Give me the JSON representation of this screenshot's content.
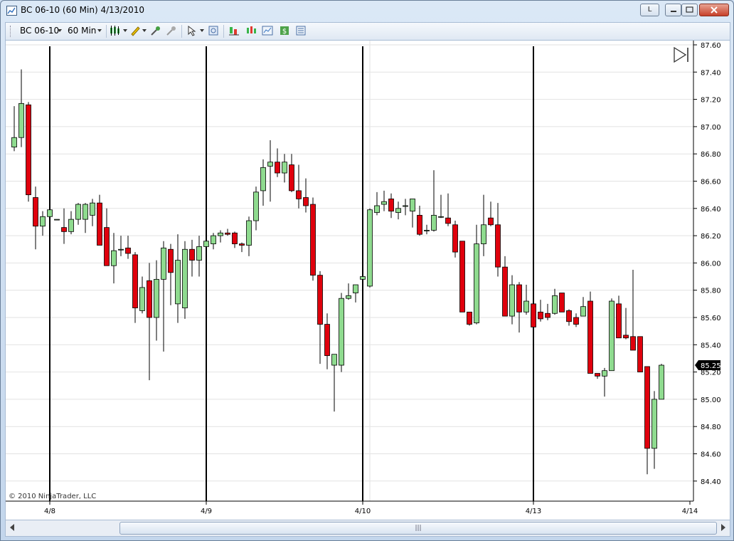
{
  "window": {
    "title": "BC 06-10 (60 Min)  4/13/2010",
    "buttons": {
      "minimize": "L"
    }
  },
  "toolbar": {
    "instrument": "BC 06-10",
    "interval": "60 Min"
  },
  "icons": [
    "chart-style-icon",
    "drawing-tool-icon",
    "zoom-in-icon",
    "zoom-out-icon",
    "cursor-icon",
    "data-box-icon",
    "indicators-icon",
    "strategies-icon",
    "chart-trader-icon",
    "dollar-icon",
    "properties-icon",
    "scroll-end-icon"
  ],
  "colors": {
    "up": "#8fdb8f",
    "down": "#e0000d",
    "wick": "#000000",
    "grid": "#e2e2e2",
    "sessionLine": "#000000",
    "priceMarker": "#000000"
  },
  "chart_data": {
    "type": "candlestick",
    "y_axis_side": "right",
    "ylim": [
      84.3,
      87.6
    ],
    "y_ticks": [
      "87.60",
      "87.40",
      "87.20",
      "87.00",
      "86.80",
      "86.60",
      "86.40",
      "86.20",
      "86.00",
      "85.80",
      "85.60",
      "85.40",
      "85.20",
      "85.00",
      "84.80",
      "84.60",
      "84.40"
    ],
    "x_ticks": [
      "4/8",
      "4/9",
      "4/10",
      "4/13",
      "4/14"
    ],
    "session_breaks": [
      "4/8",
      "4/9",
      "4/10",
      "4/13"
    ],
    "last_price": "85.25",
    "copyright": "© 2010 NinjaTrader, LLC",
    "candles": [
      [
        86.85,
        87.15,
        86.82,
        86.92
      ],
      [
        86.92,
        87.42,
        86.85,
        87.17
      ],
      [
        87.16,
        87.18,
        86.45,
        86.5
      ],
      [
        86.48,
        86.56,
        86.1,
        86.27
      ],
      [
        86.27,
        86.38,
        86.2,
        86.34
      ],
      [
        86.34,
        86.42,
        86.2,
        86.39
      ],
      [
        86.32,
        86.32,
        86.32,
        86.32
      ],
      [
        86.26,
        86.4,
        86.14,
        86.23
      ],
      [
        86.23,
        86.38,
        86.21,
        86.32
      ],
      [
        86.32,
        86.44,
        86.28,
        86.43
      ],
      [
        86.32,
        86.44,
        86.22,
        86.43
      ],
      [
        86.35,
        86.47,
        86.27,
        86.44
      ],
      [
        86.44,
        86.5,
        86.14,
        86.13
      ],
      [
        86.26,
        86.4,
        85.98,
        85.98
      ],
      [
        85.98,
        86.22,
        85.85,
        86.09
      ],
      [
        86.1,
        86.2,
        86.05,
        86.1
      ],
      [
        86.11,
        86.2,
        86.03,
        86.07
      ],
      [
        86.06,
        86.08,
        85.56,
        85.67
      ],
      [
        85.65,
        85.9,
        85.63,
        85.82
      ],
      [
        85.87,
        86.0,
        85.14,
        85.6
      ],
      [
        85.6,
        86.02,
        85.43,
        85.88
      ],
      [
        85.88,
        86.16,
        85.35,
        86.11
      ],
      [
        86.1,
        86.14,
        85.69,
        85.93
      ],
      [
        85.7,
        86.21,
        85.56,
        86.02
      ],
      [
        85.67,
        86.16,
        85.59,
        86.1
      ],
      [
        86.1,
        86.17,
        85.9,
        86.02
      ],
      [
        86.02,
        86.2,
        85.9,
        86.12
      ],
      [
        86.12,
        86.22,
        85.9,
        86.16
      ],
      [
        86.14,
        86.22,
        86.1,
        86.2
      ],
      [
        86.2,
        86.24,
        86.15,
        86.22
      ],
      [
        86.22,
        86.25,
        86.2,
        86.21
      ],
      [
        86.22,
        86.23,
        86.11,
        86.14
      ],
      [
        86.14,
        86.15,
        86.08,
        86.13
      ],
      [
        86.13,
        86.34,
        86.05,
        86.31
      ],
      [
        86.31,
        86.56,
        86.24,
        86.52
      ],
      [
        86.53,
        86.76,
        86.42,
        86.7
      ],
      [
        86.71,
        86.9,
        86.45,
        86.74
      ],
      [
        86.74,
        86.84,
        86.63,
        86.66
      ],
      [
        86.66,
        86.8,
        86.59,
        86.74
      ],
      [
        86.72,
        86.8,
        86.52,
        86.53
      ],
      [
        86.53,
        86.72,
        86.4,
        86.47
      ],
      [
        86.48,
        86.62,
        86.37,
        86.42
      ],
      [
        86.43,
        86.48,
        85.87,
        85.91
      ],
      [
        85.91,
        85.94,
        85.26,
        85.55
      ],
      [
        85.55,
        85.63,
        85.22,
        85.32
      ],
      [
        85.25,
        85.28,
        84.91,
        85.33
      ],
      [
        85.25,
        85.78,
        85.2,
        85.74
      ],
      [
        85.74,
        85.85,
        85.73,
        85.76
      ],
      [
        85.78,
        85.82,
        85.71,
        85.84
      ],
      [
        85.88,
        85.93,
        85.78,
        85.9
      ],
      [
        85.83,
        86.4,
        85.82,
        86.39
      ],
      [
        86.37,
        86.52,
        86.35,
        86.42
      ],
      [
        86.43,
        86.53,
        86.38,
        86.45
      ],
      [
        86.47,
        86.51,
        86.33,
        86.38
      ],
      [
        86.37,
        86.45,
        86.32,
        86.4
      ],
      [
        86.42,
        86.47,
        86.35,
        86.42
      ],
      [
        86.38,
        86.47,
        86.26,
        86.47
      ],
      [
        86.35,
        86.42,
        86.2,
        86.21
      ],
      [
        86.24,
        86.28,
        86.21,
        86.24
      ],
      [
        86.24,
        86.68,
        86.23,
        86.35
      ],
      [
        86.34,
        86.5,
        86.33,
        86.34
      ],
      [
        86.33,
        86.51,
        86.27,
        86.29
      ],
      [
        86.28,
        86.31,
        86.04,
        86.08
      ],
      [
        86.16,
        86.16,
        85.64,
        85.64
      ],
      [
        85.64,
        85.6,
        85.54,
        85.55
      ],
      [
        85.56,
        86.28,
        85.55,
        86.14
      ],
      [
        86.14,
        86.5,
        86.05,
        86.28
      ],
      [
        86.33,
        86.45,
        86.27,
        86.28
      ],
      [
        86.28,
        86.44,
        85.9,
        85.97
      ],
      [
        85.97,
        86.05,
        85.62,
        85.61
      ],
      [
        85.61,
        85.91,
        85.55,
        85.84
      ],
      [
        85.84,
        85.86,
        85.49,
        85.64
      ],
      [
        85.64,
        85.84,
        85.62,
        85.72
      ],
      [
        85.7,
        85.74,
        85.51,
        85.53
      ],
      [
        85.64,
        85.73,
        85.57,
        85.59
      ],
      [
        85.63,
        85.7,
        85.58,
        85.6
      ],
      [
        85.63,
        85.81,
        85.62,
        85.76
      ],
      [
        85.78,
        85.78,
        85.64,
        85.64
      ],
      [
        85.65,
        85.66,
        85.54,
        85.57
      ],
      [
        85.6,
        85.63,
        85.53,
        85.55
      ],
      [
        85.61,
        85.75,
        85.61,
        85.68
      ],
      [
        85.72,
        85.79,
        85.21,
        85.19
      ],
      [
        85.19,
        85.15,
        85.15,
        85.17
      ],
      [
        85.17,
        85.23,
        85.02,
        85.21
      ],
      [
        85.21,
        85.74,
        85.24,
        85.72
      ],
      [
        85.7,
        85.76,
        85.45,
        85.45
      ],
      [
        85.47,
        85.67,
        85.44,
        85.45
      ],
      [
        85.46,
        85.95,
        85.36,
        85.36
      ],
      [
        85.46,
        85.43,
        85.2,
        85.2
      ],
      [
        85.24,
        85.24,
        84.45,
        84.64
      ],
      [
        84.64,
        85.06,
        84.49,
        85.0
      ],
      [
        85.0,
        85.26,
        85.0,
        85.25
      ]
    ]
  }
}
